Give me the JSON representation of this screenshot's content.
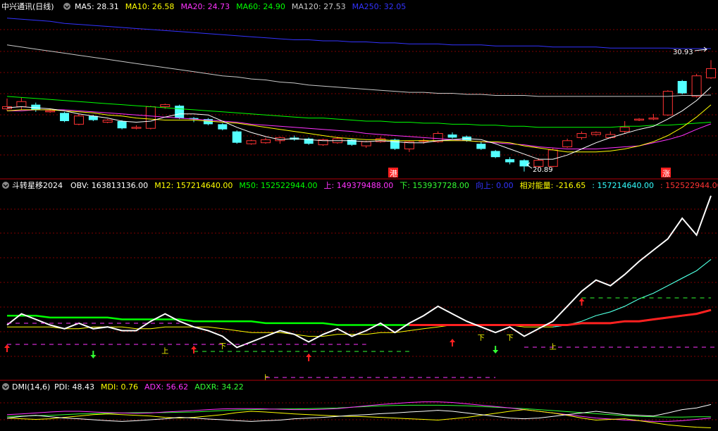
{
  "panel1": {
    "title": "中兴通讯(日线)",
    "ma_labels": [
      {
        "text": "MA5: 28.31",
        "color": "#ffffff"
      },
      {
        "text": "MA10: 26.58",
        "color": "#ffff00"
      },
      {
        "text": "MA20: 24.73",
        "color": "#ff33ff"
      },
      {
        "text": "MA60: 24.90",
        "color": "#00ff00"
      },
      {
        "text": "MA120: 27.53",
        "color": "#c8c8c8"
      },
      {
        "text": "MA250: 32.05",
        "color": "#3333ff"
      }
    ],
    "high_label": "30.93",
    "low_label": "20.89",
    "marker_left": "港",
    "marker_right": "涨"
  },
  "panel2": {
    "title": "斗转星移2024",
    "labels": [
      {
        "text": "OBV: 163813136.00",
        "color": "#ffffff"
      },
      {
        "text": "M12: 157214640.00",
        "color": "#ffff00"
      },
      {
        "text": "M50: 152522944.00",
        "color": "#00ff00"
      },
      {
        "text": "上: 149379488.00",
        "color": "#ff33ff"
      },
      {
        "text": "下: 153937728.00",
        "color": "#33ff33"
      },
      {
        "text": "向上: 0.00",
        "color": "#3333ff"
      },
      {
        "text": "相对能量: -216.65",
        "color": "#ffff00"
      },
      {
        "text": ": 157214640.00",
        "color": "#33ffff"
      },
      {
        "text": ": 152522944.00",
        "color": "#ff3333"
      }
    ],
    "up_mark": "上",
    "down_mark": "下"
  },
  "panel3": {
    "title": "DMI(14,6)",
    "labels": [
      {
        "text": "PDI: 48.43",
        "color": "#ffffff"
      },
      {
        "text": "MDI: 0.76",
        "color": "#ffff00"
      },
      {
        "text": "ADX: 56.62",
        "color": "#ff33ff"
      },
      {
        "text": "ADXR: 34.22",
        "color": "#33ff33"
      }
    ]
  },
  "colors": {
    "up": "#ff3333",
    "down": "#54ffff",
    "grid": "#800000",
    "frame": "#b0000a",
    "ma5": "#ffffff",
    "ma10": "#ffff00",
    "ma20": "#ff33ff",
    "ma60": "#00ff00",
    "ma120": "#c8c8c8",
    "ma250": "#3333ff"
  },
  "chart_data": {
    "type": "candlestick",
    "candles": [
      {
        "o": 26.2,
        "c": 26.4,
        "h": 27.2,
        "l": 26.0
      },
      {
        "o": 26.4,
        "c": 26.9,
        "h": 27.3,
        "l": 26.1
      },
      {
        "o": 26.6,
        "c": 26.1,
        "h": 26.8,
        "l": 25.9
      },
      {
        "o": 25.9,
        "c": 26.0,
        "h": 26.2,
        "l": 25.8
      },
      {
        "o": 25.8,
        "c": 25.0,
        "h": 25.9,
        "l": 24.9
      },
      {
        "o": 24.7,
        "c": 25.5,
        "h": 25.7,
        "l": 24.6
      },
      {
        "o": 25.5,
        "c": 25.1,
        "h": 25.6,
        "l": 25.0
      },
      {
        "o": 24.9,
        "c": 25.1,
        "h": 25.2,
        "l": 24.8
      },
      {
        "o": 25.0,
        "c": 24.3,
        "h": 25.1,
        "l": 24.2
      },
      {
        "o": 24.3,
        "c": 24.4,
        "h": 24.6,
        "l": 24.2
      },
      {
        "o": 24.3,
        "c": 26.4,
        "h": 26.5,
        "l": 24.2
      },
      {
        "o": 26.4,
        "c": 26.6,
        "h": 26.7,
        "l": 26.2
      },
      {
        "o": 26.5,
        "c": 25.3,
        "h": 26.6,
        "l": 25.2
      },
      {
        "o": 25.3,
        "c": 25.2,
        "h": 25.4,
        "l": 24.9
      },
      {
        "o": 25.2,
        "c": 24.7,
        "h": 25.3,
        "l": 24.6
      },
      {
        "o": 24.7,
        "c": 24.2,
        "h": 24.8,
        "l": 24.1
      },
      {
        "o": 24.0,
        "c": 22.9,
        "h": 24.1,
        "l": 22.8
      },
      {
        "o": 22.8,
        "c": 23.1,
        "h": 23.2,
        "l": 22.7
      },
      {
        "o": 22.9,
        "c": 23.2,
        "h": 23.4,
        "l": 22.8
      },
      {
        "o": 23.1,
        "c": 23.4,
        "h": 23.5,
        "l": 22.8
      },
      {
        "o": 23.4,
        "c": 23.2,
        "h": 23.6,
        "l": 23.1
      },
      {
        "o": 23.3,
        "c": 22.8,
        "h": 23.4,
        "l": 22.7
      },
      {
        "o": 22.7,
        "c": 23.2,
        "h": 23.3,
        "l": 22.6
      },
      {
        "o": 22.9,
        "c": 23.3,
        "h": 23.5,
        "l": 22.8
      },
      {
        "o": 23.2,
        "c": 22.7,
        "h": 23.3,
        "l": 22.6
      },
      {
        "o": 22.6,
        "c": 23.0,
        "h": 23.1,
        "l": 22.4
      },
      {
        "o": 23.0,
        "c": 23.3,
        "h": 23.5,
        "l": 22.9
      },
      {
        "o": 23.2,
        "c": 22.3,
        "h": 23.3,
        "l": 22.2
      },
      {
        "o": 22.3,
        "c": 23.0,
        "h": 23.1,
        "l": 22.0
      },
      {
        "o": 23.1,
        "c": 23.1,
        "h": 23.3,
        "l": 22.8
      },
      {
        "o": 23.0,
        "c": 23.8,
        "h": 24.0,
        "l": 22.9
      },
      {
        "o": 23.7,
        "c": 23.4,
        "h": 23.9,
        "l": 23.3
      },
      {
        "o": 23.5,
        "c": 23.1,
        "h": 23.6,
        "l": 23.0
      },
      {
        "o": 22.8,
        "c": 22.3,
        "h": 23.0,
        "l": 22.2
      },
      {
        "o": 22.1,
        "c": 21.5,
        "h": 22.2,
        "l": 21.4
      },
      {
        "o": 21.3,
        "c": 21.0,
        "h": 21.5,
        "l": 20.8
      },
      {
        "o": 21.2,
        "c": 20.6,
        "h": 21.3,
        "l": 20.1
      },
      {
        "o": 20.6,
        "c": 21.2,
        "h": 21.4,
        "l": 20.5
      },
      {
        "o": 20.6,
        "c": 22.2,
        "h": 22.4,
        "l": 20.5
      },
      {
        "o": 22.5,
        "c": 23.1,
        "h": 23.3,
        "l": 22.4
      },
      {
        "o": 23.4,
        "c": 23.8,
        "h": 24.0,
        "l": 23.2
      },
      {
        "o": 23.7,
        "c": 23.9,
        "h": 24.0,
        "l": 23.6
      },
      {
        "o": 23.4,
        "c": 23.7,
        "h": 24.0,
        "l": 23.3
      },
      {
        "o": 24.0,
        "c": 24.4,
        "h": 25.0,
        "l": 23.8
      },
      {
        "o": 25.1,
        "c": 25.2,
        "h": 25.3,
        "l": 25.0
      },
      {
        "o": 25.2,
        "c": 25.3,
        "h": 25.7,
        "l": 25.1
      },
      {
        "o": 25.6,
        "c": 27.9,
        "h": 28.0,
        "l": 25.5
      },
      {
        "o": 28.9,
        "c": 27.7,
        "h": 29.0,
        "l": 27.6
      },
      {
        "o": 27.4,
        "c": 29.4,
        "h": 29.6,
        "l": 27.3
      },
      {
        "o": 29.2,
        "c": 30.1,
        "h": 30.93,
        "l": 29.1
      }
    ],
    "ma5": [
      26.3,
      26.4,
      26.3,
      26.2,
      26.0,
      25.7,
      25.5,
      25.3,
      25.0,
      24.9,
      25.0,
      25.4,
      25.7,
      25.7,
      25.6,
      25.0,
      24.4,
      23.9,
      23.5,
      23.2,
      23.3,
      23.2,
      23.1,
      23.1,
      23.1,
      23.0,
      23.1,
      23.0,
      22.9,
      22.9,
      23.1,
      23.2,
      23.3,
      23.2,
      22.8,
      22.3,
      21.8,
      21.3,
      21.3,
      21.7,
      22.3,
      22.9,
      23.4,
      23.8,
      24.2,
      24.5,
      25.2,
      26.0,
      27.0,
      28.31
    ],
    "ma10": [
      26.0,
      26.1,
      26.1,
      26.1,
      26.0,
      25.9,
      25.8,
      25.6,
      25.5,
      25.3,
      25.2,
      25.1,
      25.1,
      25.1,
      25.0,
      24.9,
      24.8,
      24.6,
      24.4,
      24.2,
      24.0,
      23.8,
      23.6,
      23.4,
      23.3,
      23.2,
      23.2,
      23.1,
      23.1,
      23.1,
      23.1,
      23.1,
      23.1,
      23.0,
      23.0,
      22.9,
      22.6,
      22.4,
      22.2,
      22.0,
      22.0,
      22.0,
      22.1,
      22.3,
      22.6,
      23.0,
      23.6,
      24.4,
      25.4,
      26.58
    ],
    "ma20": [
      26.0,
      26.0,
      26.1,
      26.1,
      26.1,
      26.0,
      25.9,
      25.8,
      25.7,
      25.6,
      25.5,
      25.4,
      25.3,
      25.2,
      25.1,
      25.0,
      24.9,
      24.7,
      24.6,
      24.5,
      24.4,
      24.3,
      24.2,
      24.1,
      24.0,
      23.8,
      23.7,
      23.6,
      23.5,
      23.4,
      23.3,
      23.2,
      23.1,
      23.0,
      22.9,
      22.8,
      22.7,
      22.5,
      22.4,
      22.3,
      22.3,
      22.3,
      22.4,
      22.5,
      22.6,
      22.9,
      23.2,
      23.6,
      24.2,
      24.73
    ],
    "ma60": [
      27.4,
      27.3,
      27.2,
      27.1,
      27.0,
      26.9,
      26.8,
      26.7,
      26.6,
      26.5,
      26.4,
      26.3,
      26.2,
      26.1,
      26.0,
      25.9,
      25.8,
      25.7,
      25.6,
      25.5,
      25.4,
      25.3,
      25.3,
      25.2,
      25.1,
      25.0,
      25.0,
      24.9,
      24.9,
      24.8,
      24.8,
      24.7,
      24.7,
      24.6,
      24.6,
      24.5,
      24.5,
      24.4,
      24.4,
      24.4,
      24.4,
      24.4,
      24.4,
      24.5,
      24.5,
      24.6,
      24.6,
      24.7,
      24.8,
      24.9
    ],
    "ma120": [
      32.4,
      32.2,
      32.0,
      31.8,
      31.6,
      31.4,
      31.2,
      31.0,
      30.8,
      30.6,
      30.4,
      30.2,
      30.0,
      29.8,
      29.6,
      29.4,
      29.3,
      29.1,
      29.0,
      28.8,
      28.7,
      28.5,
      28.4,
      28.3,
      28.2,
      28.1,
      28.0,
      27.9,
      27.8,
      27.8,
      27.7,
      27.7,
      27.6,
      27.6,
      27.5,
      27.5,
      27.5,
      27.4,
      27.4,
      27.4,
      27.4,
      27.4,
      27.4,
      27.4,
      27.4,
      27.4,
      27.4,
      27.5,
      27.5,
      27.53
    ],
    "ma250": [
      35.0,
      34.9,
      34.8,
      34.7,
      34.5,
      34.4,
      34.3,
      34.2,
      34.1,
      34.0,
      33.9,
      33.8,
      33.7,
      33.6,
      33.5,
      33.4,
      33.3,
      33.2,
      33.1,
      33.0,
      32.9,
      32.9,
      32.8,
      32.8,
      32.7,
      32.7,
      32.6,
      32.6,
      32.5,
      32.5,
      32.5,
      32.4,
      32.4,
      32.4,
      32.3,
      32.3,
      32.3,
      32.3,
      32.2,
      32.2,
      32.2,
      32.2,
      32.1,
      32.1,
      32.1,
      32.1,
      32.1,
      32.05,
      32.05,
      32.05
    ],
    "obv": [
      0.28,
      0.34,
      0.31,
      0.28,
      0.26,
      0.29,
      0.26,
      0.27,
      0.25,
      0.25,
      0.3,
      0.34,
      0.3,
      0.27,
      0.25,
      0.22,
      0.16,
      0.19,
      0.22,
      0.25,
      0.23,
      0.19,
      0.23,
      0.26,
      0.22,
      0.25,
      0.29,
      0.24,
      0.29,
      0.33,
      0.38,
      0.34,
      0.3,
      0.27,
      0.24,
      0.27,
      0.22,
      0.26,
      0.3,
      0.38,
      0.46,
      0.52,
      0.49,
      0.55,
      0.62,
      0.68,
      0.74,
      0.85,
      0.76,
      0.97
    ],
    "m12": [
      0.27,
      0.27,
      0.27,
      0.27,
      0.26,
      0.26,
      0.27,
      0.27,
      0.27,
      0.26,
      0.26,
      0.27,
      0.27,
      0.27,
      0.27,
      0.26,
      0.25,
      0.24,
      0.24,
      0.24,
      0.23,
      0.22,
      0.22,
      0.23,
      0.23,
      0.23,
      0.24,
      0.24,
      0.25,
      0.26,
      0.27,
      0.28,
      0.28,
      0.28,
      0.28,
      0.28,
      0.27,
      0.27,
      0.27,
      0.28,
      0.3,
      0.33,
      0.35,
      0.38,
      0.42,
      0.45,
      0.49,
      0.53,
      0.57,
      0.63
    ],
    "m50": [
      0.33,
      0.33,
      0.33,
      0.32,
      0.32,
      0.32,
      0.32,
      0.32,
      0.31,
      0.31,
      0.31,
      0.31,
      0.31,
      0.3,
      0.3,
      0.3,
      0.3,
      0.3,
      0.29,
      0.29,
      0.29,
      0.29,
      0.29,
      0.28,
      0.28,
      0.28,
      0.28,
      0.28,
      0.28,
      0.28,
      0.28,
      0.28,
      0.28,
      0.28,
      0.28,
      0.28,
      0.28,
      0.28,
      0.28,
      0.28,
      0.29,
      0.29,
      0.29,
      0.3,
      0.3,
      0.31,
      0.32,
      0.33,
      0.34,
      0.36
    ],
    "adx": [
      0.4,
      0.42,
      0.45,
      0.48,
      0.5,
      0.5,
      0.48,
      0.46,
      0.45,
      0.44,
      0.45,
      0.48,
      0.5,
      0.52,
      0.55,
      0.57,
      0.58,
      0.58,
      0.57,
      0.56,
      0.55,
      0.55,
      0.56,
      0.58,
      0.62,
      0.66,
      0.7,
      0.73,
      0.76,
      0.78,
      0.78,
      0.76,
      0.72,
      0.68,
      0.64,
      0.6,
      0.55,
      0.5,
      0.45,
      0.4,
      0.35,
      0.3,
      0.27,
      0.24,
      0.22,
      0.2,
      0.2,
      0.22,
      0.26,
      0.3
    ],
    "adxr": [
      0.35,
      0.36,
      0.37,
      0.38,
      0.4,
      0.42,
      0.43,
      0.44,
      0.45,
      0.46,
      0.46,
      0.46,
      0.47,
      0.48,
      0.5,
      0.52,
      0.54,
      0.55,
      0.56,
      0.57,
      0.57,
      0.58,
      0.59,
      0.6,
      0.62,
      0.64,
      0.66,
      0.67,
      0.68,
      0.68,
      0.68,
      0.67,
      0.66,
      0.64,
      0.62,
      0.6,
      0.58,
      0.55,
      0.52,
      0.49,
      0.46,
      0.43,
      0.4,
      0.37,
      0.35,
      0.34,
      0.33,
      0.33,
      0.34,
      0.34
    ],
    "pdi": [
      0.3,
      0.35,
      0.38,
      0.34,
      0.3,
      0.28,
      0.25,
      0.22,
      0.2,
      0.22,
      0.25,
      0.28,
      0.32,
      0.3,
      0.27,
      0.25,
      0.22,
      0.2,
      0.22,
      0.24,
      0.28,
      0.3,
      0.32,
      0.35,
      0.38,
      0.4,
      0.43,
      0.45,
      0.48,
      0.5,
      0.53,
      0.5,
      0.45,
      0.4,
      0.35,
      0.3,
      0.28,
      0.3,
      0.35,
      0.4,
      0.45,
      0.5,
      0.45,
      0.4,
      0.38,
      0.36,
      0.45,
      0.55,
      0.6,
      0.7
    ],
    "mdi": [
      0.3,
      0.28,
      0.26,
      0.28,
      0.32,
      0.36,
      0.4,
      0.42,
      0.4,
      0.38,
      0.36,
      0.32,
      0.3,
      0.32,
      0.36,
      0.4,
      0.46,
      0.5,
      0.48,
      0.45,
      0.42,
      0.4,
      0.38,
      0.36,
      0.35,
      0.34,
      0.32,
      0.3,
      0.28,
      0.26,
      0.24,
      0.28,
      0.32,
      0.38,
      0.44,
      0.5,
      0.55,
      0.5,
      0.45,
      0.38,
      0.3,
      0.24,
      0.26,
      0.28,
      0.22,
      0.16,
      0.1,
      0.06,
      0.03,
      0.01
    ]
  }
}
